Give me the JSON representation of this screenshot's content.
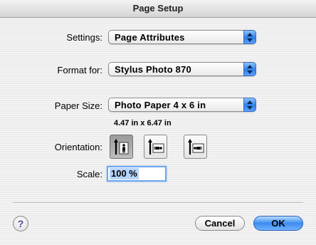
{
  "window": {
    "title": "Page Setup"
  },
  "settings": {
    "label": "Settings:",
    "value": "Page Attributes"
  },
  "format": {
    "label": "Format for:",
    "value": "Stylus Photo 870"
  },
  "paper": {
    "label": "Paper Size:",
    "value": "Photo Paper 4 x 6 in",
    "dimensions": "4.47 in x 6.47 in"
  },
  "orientation": {
    "label": "Orientation:",
    "options": [
      "portrait",
      "landscape",
      "landscape-reversed"
    ],
    "selected": "portrait"
  },
  "scale": {
    "label": "Scale:",
    "value": "100 %"
  },
  "buttons": {
    "help": "?",
    "cancel": "Cancel",
    "ok": "OK"
  },
  "colors": {
    "accent": "#3d8cf0",
    "background": "#ececec"
  }
}
